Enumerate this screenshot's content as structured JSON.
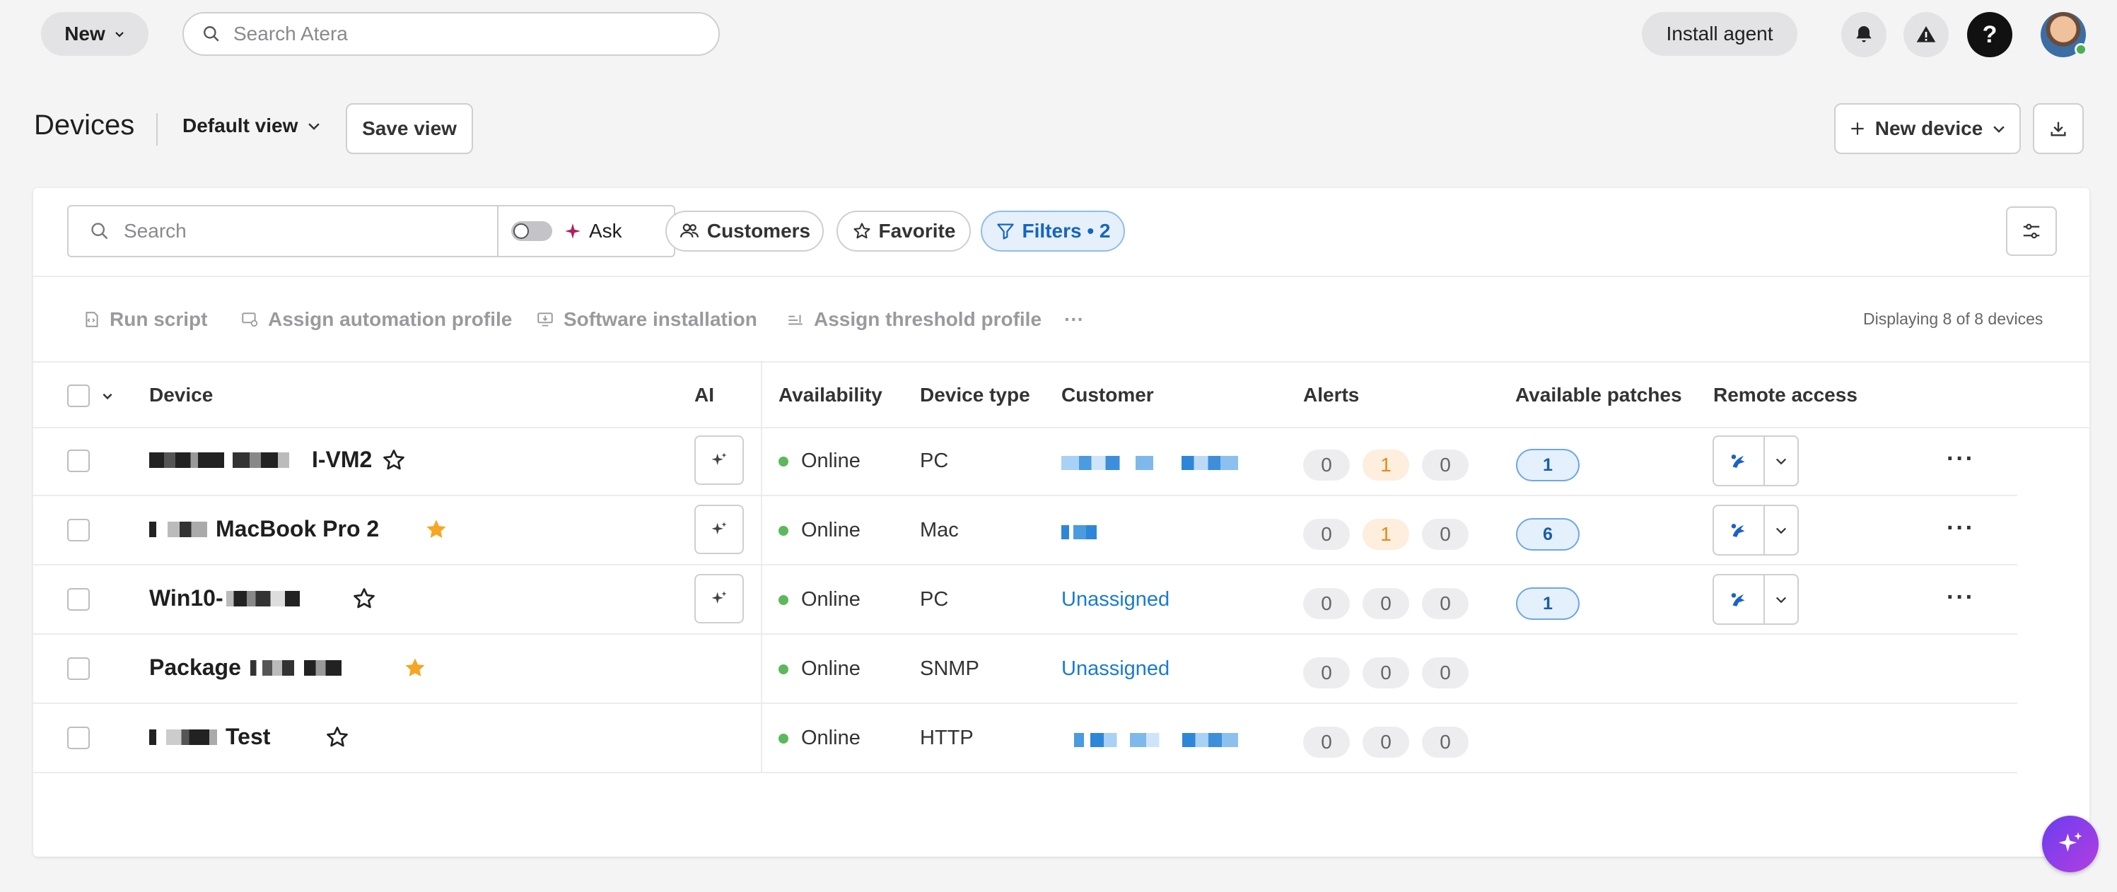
{
  "topbar": {
    "new_label": "New",
    "search_placeholder": "Search Atera",
    "install_label": "Install agent",
    "help_label": "?"
  },
  "header": {
    "title": "Devices",
    "view_label": "Default view",
    "save_view_label": "Save view",
    "new_device_label": "New device"
  },
  "toolbar": {
    "search_placeholder": "Search",
    "ask_label": "Ask",
    "chips": {
      "customers": "Customers",
      "favorite": "Favorite",
      "filters": "Filters • 2"
    }
  },
  "actions": {
    "run_script": "Run script",
    "assign_automation": "Assign automation profile",
    "software_install": "Software installation",
    "assign_threshold": "Assign threshold profile",
    "more": "···",
    "displaying": "Displaying 8 of 8 devices"
  },
  "columns": {
    "device": "Device",
    "ai": "AI",
    "availability": "Availability",
    "device_type": "Device type",
    "customer": "Customer",
    "alerts": "Alerts",
    "patches": "Available patches",
    "remote": "Remote access"
  },
  "rows": [
    {
      "name": "I-VM2",
      "favorite": false,
      "status": "Online",
      "type": "PC",
      "customer": "",
      "alerts": [
        "0",
        "1",
        "0"
      ],
      "patches": "1"
    },
    {
      "name": "MacBook Pro 2",
      "favorite": true,
      "status": "Online",
      "type": "Mac",
      "customer": "",
      "alerts": [
        "0",
        "1",
        "0"
      ],
      "patches": "6"
    },
    {
      "name": "Win10-",
      "favorite": false,
      "status": "Online",
      "type": "PC",
      "customer": "Unassigned",
      "alerts": [
        "0",
        "0",
        "0"
      ],
      "patches": "1"
    },
    {
      "name": "Package",
      "favorite": true,
      "status": "Online",
      "type": "SNMP",
      "customer": "Unassigned",
      "alerts": [
        "0",
        "0",
        "0"
      ],
      "patches": ""
    },
    {
      "name": "Test",
      "favorite": false,
      "status": "Online",
      "type": "HTTP",
      "customer": "",
      "alerts": [
        "0",
        "0",
        "0"
      ],
      "patches": ""
    }
  ],
  "colors": {
    "accent": "#1a7bd0",
    "online": "#5cb85c",
    "star": "#f5a623",
    "warn": "#e08a1c"
  }
}
